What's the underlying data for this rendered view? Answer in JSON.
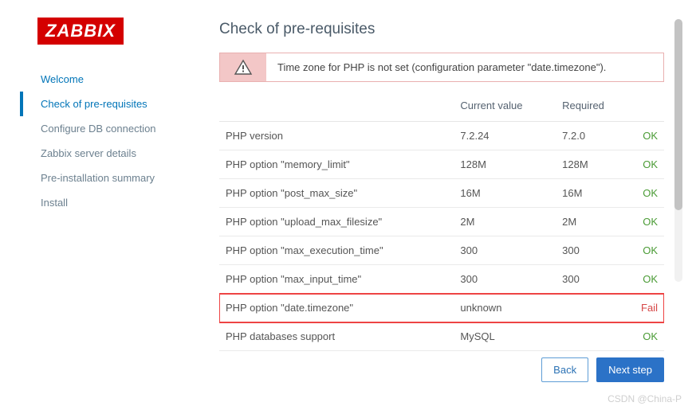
{
  "logo": "ZABBIX",
  "sidebar": {
    "items": [
      {
        "label": "Welcome",
        "state": "done"
      },
      {
        "label": "Check of pre-requisites",
        "state": "active"
      },
      {
        "label": "Configure DB connection",
        "state": ""
      },
      {
        "label": "Zabbix server details",
        "state": ""
      },
      {
        "label": "Pre-installation summary",
        "state": ""
      },
      {
        "label": "Install",
        "state": ""
      }
    ]
  },
  "title": "Check of pre-requisites",
  "alert": {
    "message": "Time zone for PHP is not set (configuration parameter \"date.timezone\")."
  },
  "table": {
    "headers": {
      "name": "",
      "current": "Current value",
      "required": "Required",
      "status": ""
    },
    "rows": [
      {
        "name": "PHP version",
        "current": "7.2.24",
        "required": "7.2.0",
        "status": "OK"
      },
      {
        "name": "PHP option \"memory_limit\"",
        "current": "128M",
        "required": "128M",
        "status": "OK"
      },
      {
        "name": "PHP option \"post_max_size\"",
        "current": "16M",
        "required": "16M",
        "status": "OK"
      },
      {
        "name": "PHP option \"upload_max_filesize\"",
        "current": "2M",
        "required": "2M",
        "status": "OK"
      },
      {
        "name": "PHP option \"max_execution_time\"",
        "current": "300",
        "required": "300",
        "status": "OK"
      },
      {
        "name": "PHP option \"max_input_time\"",
        "current": "300",
        "required": "300",
        "status": "OK"
      },
      {
        "name": "PHP option \"date.timezone\"",
        "current": "unknown",
        "required": "",
        "status": "Fail",
        "highlight": true
      },
      {
        "name": "PHP databases support",
        "current": "MySQL",
        "required": "",
        "status": "OK"
      }
    ]
  },
  "buttons": {
    "back": "Back",
    "next": "Next step"
  },
  "watermark": "CSDN @China-P"
}
